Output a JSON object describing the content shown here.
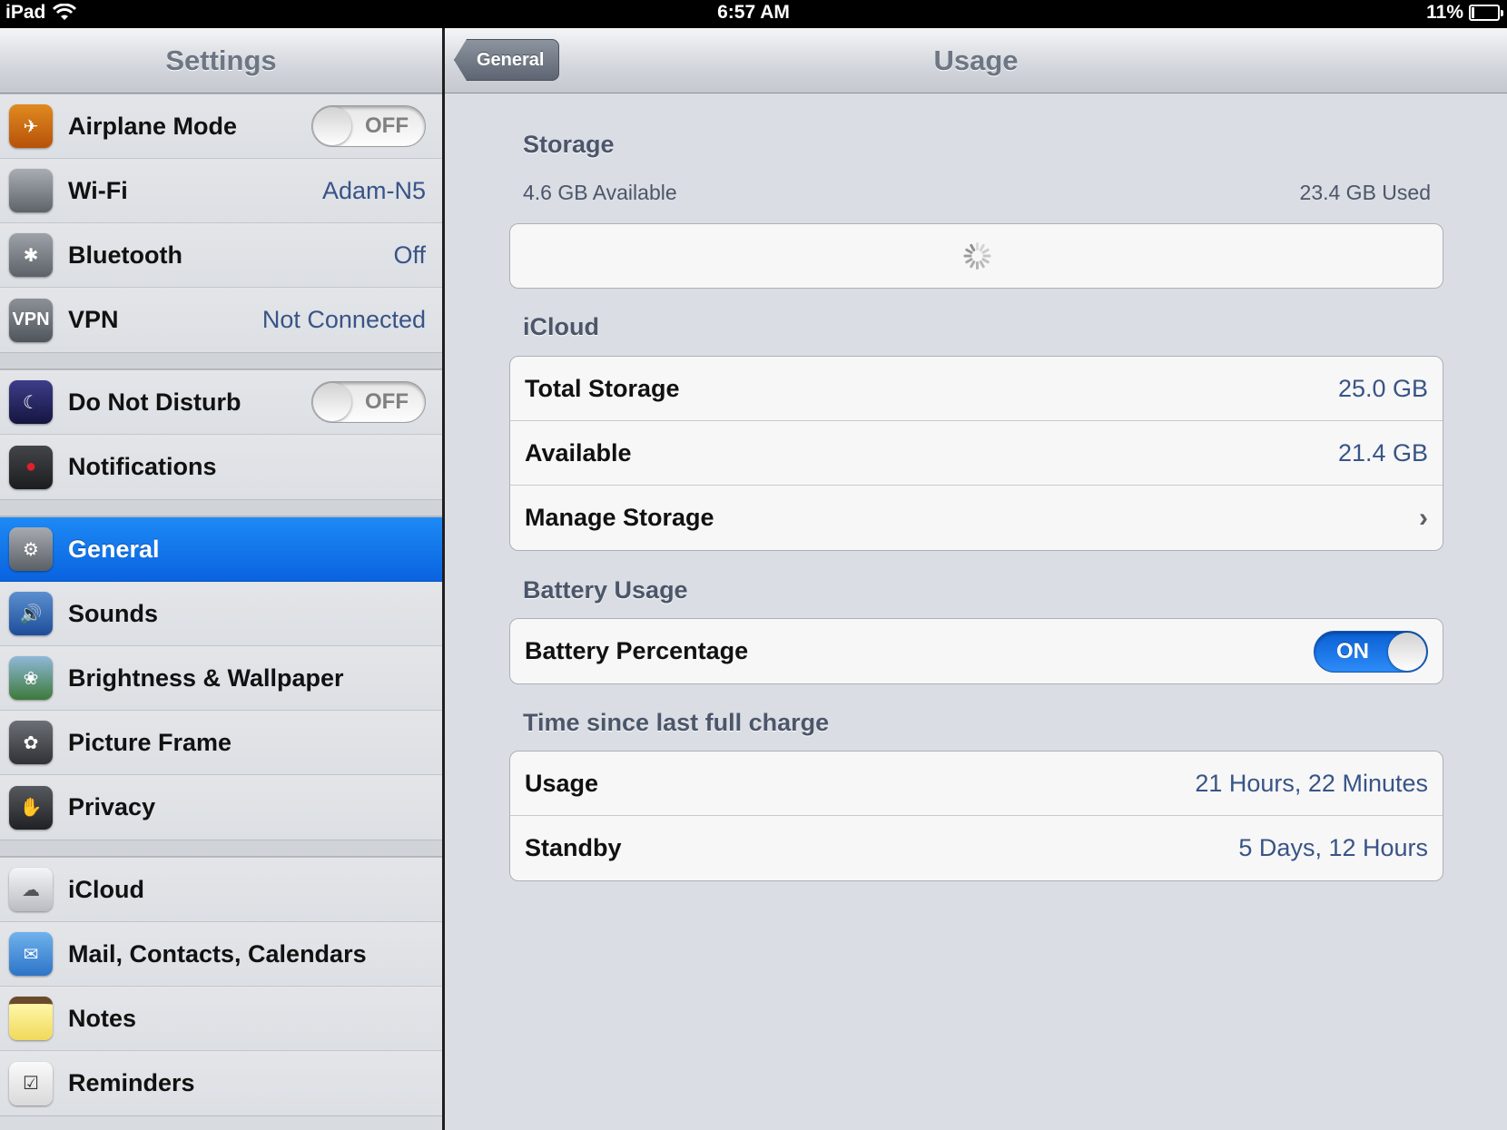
{
  "status_bar": {
    "device": "iPad",
    "time": "6:57 AM",
    "battery_percent": "11%",
    "battery_level": 0.11
  },
  "sidebar": {
    "title": "Settings",
    "groups": [
      [
        {
          "label": "Airplane Mode",
          "icon": "airplane-icon",
          "toggle": "OFF"
        },
        {
          "label": "Wi-Fi",
          "icon": "wifi-icon",
          "value": "Adam-N5"
        },
        {
          "label": "Bluetooth",
          "icon": "bluetooth-icon",
          "value": "Off"
        },
        {
          "label": "VPN",
          "icon": "vpn-icon",
          "icon_text": "VPN",
          "value": "Not Connected"
        }
      ],
      [
        {
          "label": "Do Not Disturb",
          "icon": "moon-icon",
          "toggle": "OFF"
        },
        {
          "label": "Notifications",
          "icon": "notifications-icon"
        }
      ],
      [
        {
          "label": "General",
          "icon": "gear-icon",
          "selected": true
        },
        {
          "label": "Sounds",
          "icon": "speaker-icon"
        },
        {
          "label": "Brightness & Wallpaper",
          "icon": "flower-icon"
        },
        {
          "label": "Picture Frame",
          "icon": "picture-frame-icon"
        },
        {
          "label": "Privacy",
          "icon": "hand-icon"
        }
      ],
      [
        {
          "label": "iCloud",
          "icon": "cloud-icon"
        },
        {
          "label": "Mail, Contacts, Calendars",
          "icon": "mail-icon"
        },
        {
          "label": "Notes",
          "icon": "notes-icon"
        },
        {
          "label": "Reminders",
          "icon": "reminders-icon"
        }
      ]
    ]
  },
  "detail": {
    "back_label": "General",
    "title": "Usage",
    "storage": {
      "header": "Storage",
      "available": "4.6 GB Available",
      "used": "23.4 GB Used"
    },
    "icloud": {
      "header": "iCloud",
      "rows": [
        {
          "label": "Total Storage",
          "value": "25.0 GB"
        },
        {
          "label": "Available",
          "value": "21.4 GB"
        },
        {
          "label": "Manage Storage",
          "value": ""
        }
      ]
    },
    "battery": {
      "header": "Battery Usage",
      "label": "Battery Percentage",
      "toggle": "ON"
    },
    "charge": {
      "header": "Time since last full charge",
      "rows": [
        {
          "label": "Usage",
          "value": "21 Hours, 22 Minutes"
        },
        {
          "label": "Standby",
          "value": "5 Days, 12 Hours"
        }
      ]
    }
  },
  "colors": {
    "selected_row": "#0a63e0",
    "value_text": "#385487",
    "header_text": "#4c566a"
  }
}
